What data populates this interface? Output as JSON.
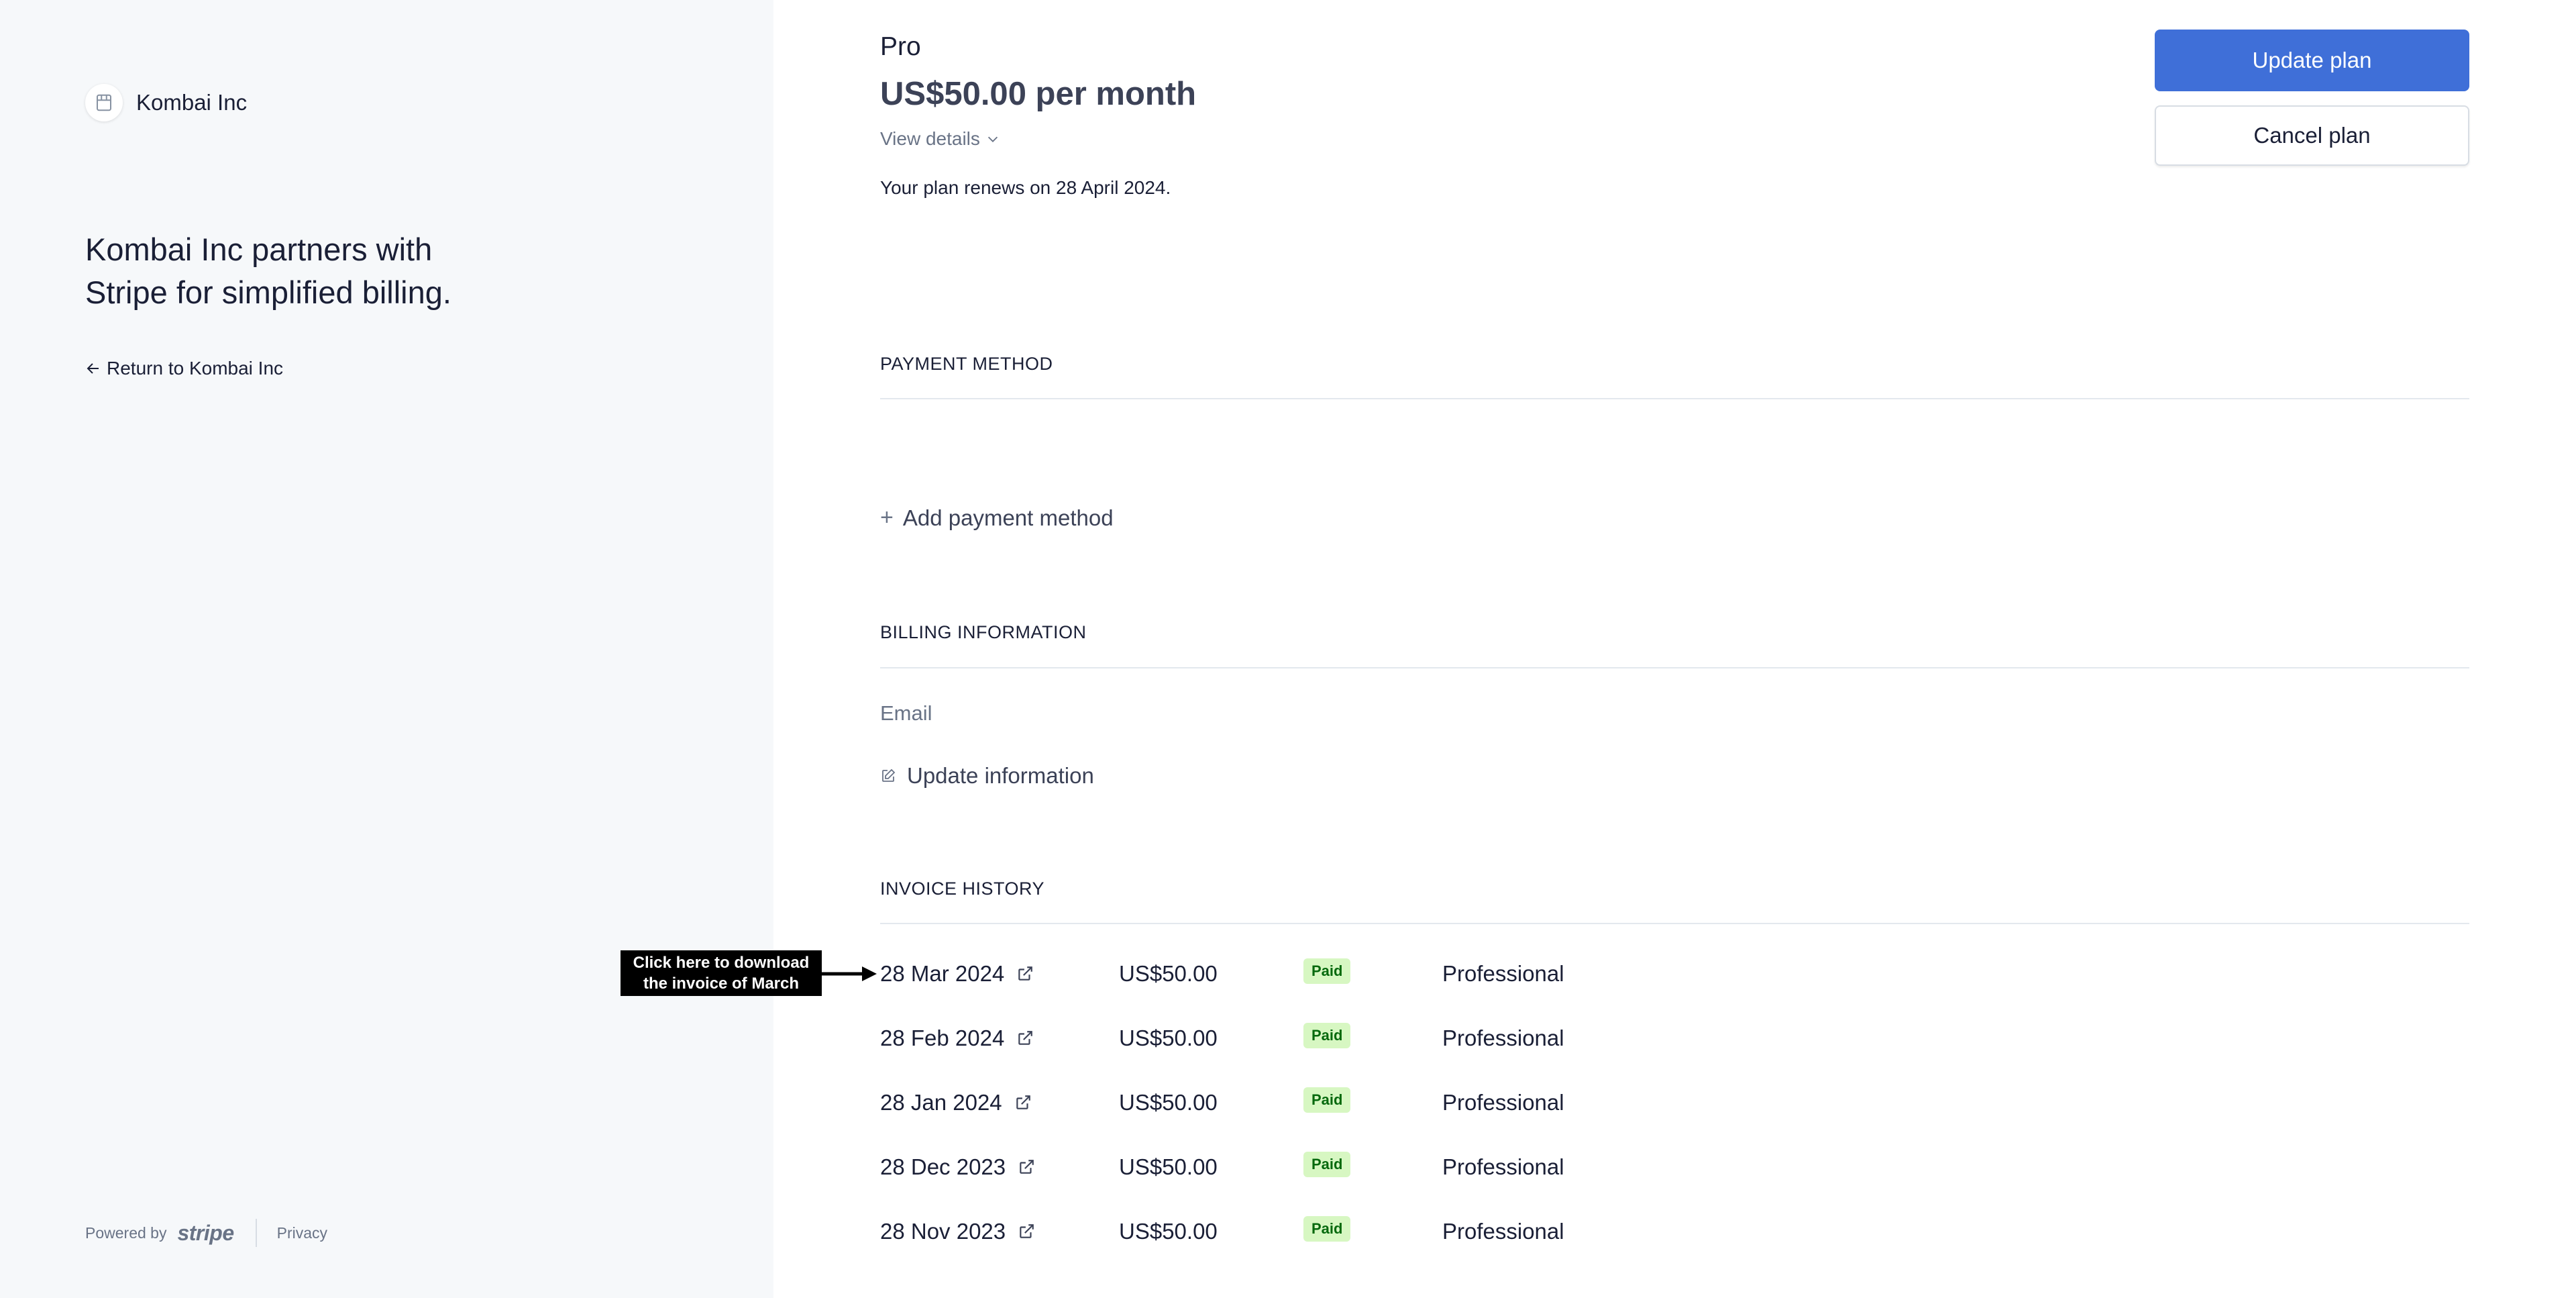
{
  "left": {
    "brand_name": "Kombai Inc",
    "tagline": "Kombai Inc partners with\nStripe for simplified billing.",
    "return_link": "Return to Kombai Inc",
    "footer": {
      "powered_by": "Powered by",
      "stripe_logo": "stripe",
      "privacy": "Privacy"
    }
  },
  "plan": {
    "name": "Pro",
    "price": "US$50.00 per month",
    "view_details": "View details",
    "renew_text": "Your plan renews on 28 April 2024.",
    "update_button": "Update plan",
    "cancel_button": "Cancel plan"
  },
  "payment_method": {
    "heading": "PAYMENT METHOD",
    "add_label": "Add payment method"
  },
  "billing_information": {
    "heading": "BILLING INFORMATION",
    "email_label": "Email",
    "update_label": "Update information"
  },
  "invoice_history": {
    "heading": "INVOICE HISTORY",
    "rows": [
      {
        "date": "28 Mar 2024",
        "amount": "US$50.00",
        "status": "Paid",
        "product": "Professional"
      },
      {
        "date": "28 Feb 2024",
        "amount": "US$50.00",
        "status": "Paid",
        "product": "Professional"
      },
      {
        "date": "28 Jan 2024",
        "amount": "US$50.00",
        "status": "Paid",
        "product": "Professional"
      },
      {
        "date": "28 Dec 2023",
        "amount": "US$50.00",
        "status": "Paid",
        "product": "Professional"
      },
      {
        "date": "28 Nov 2023",
        "amount": "US$50.00",
        "status": "Paid",
        "product": "Professional"
      }
    ]
  },
  "annotation": {
    "text": "Click here to download\nthe invoice of March"
  },
  "colors": {
    "primary_button": "#3f6fd8",
    "left_panel_bg": "#f6f8fa",
    "paid_badge_bg": "#d7f7c2",
    "paid_badge_text": "#05690d"
  },
  "icons": {
    "brand": "store-icon",
    "return": "arrow-left-icon",
    "view_details": "chevron-down-icon",
    "add_payment": "plus-icon",
    "update_info": "edit-icon",
    "invoice_link": "external-link-icon"
  }
}
